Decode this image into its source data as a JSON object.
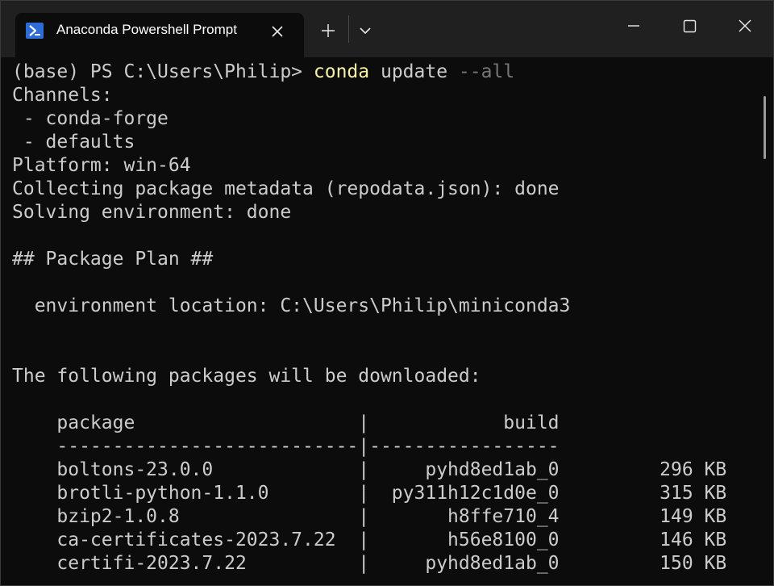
{
  "window": {
    "tab_title": "Anaconda Powershell Prompt"
  },
  "icons": {
    "tab": "powershell-icon",
    "tab_close": "close-icon",
    "new_tab": "plus-icon",
    "dropdown": "chevron-down-icon",
    "minimize": "minimize-icon",
    "maximize": "maximize-icon",
    "close": "close-icon"
  },
  "colors": {
    "background": "#0c0c0c",
    "titlebar": "#202020",
    "text": "#cccccc",
    "command": "#f9f1a5",
    "flag": "#767676",
    "icon_accent": "#2d6cd6"
  },
  "terminal": {
    "prompt": "(base) PS C:\\Users\\Philip> ",
    "command_name": "conda",
    "command_args": " update ",
    "command_flag": "--all",
    "lines": [
      "Channels:",
      " - conda-forge",
      " - defaults",
      "Platform: win-64",
      "Collecting package metadata (repodata.json): done",
      "Solving environment: done",
      "",
      "## Package Plan ##",
      "",
      "  environment location: C:\\Users\\Philip\\miniconda3",
      "",
      "",
      "The following packages will be downloaded:",
      "",
      "    package                    |            build",
      "    ---------------------------|-----------------",
      "    boltons-23.0.0             |     pyhd8ed1ab_0         296 KB",
      "    brotli-python-1.1.0        |  py311h12c1d0e_0         315 KB",
      "    bzip2-1.0.8                |       h8ffe710_4         149 KB",
      "    ca-certificates-2023.7.22  |       h56e8100_0         146 KB",
      "    certifi-2023.7.22          |     pyhd8ed1ab_0         150 KB"
    ]
  }
}
